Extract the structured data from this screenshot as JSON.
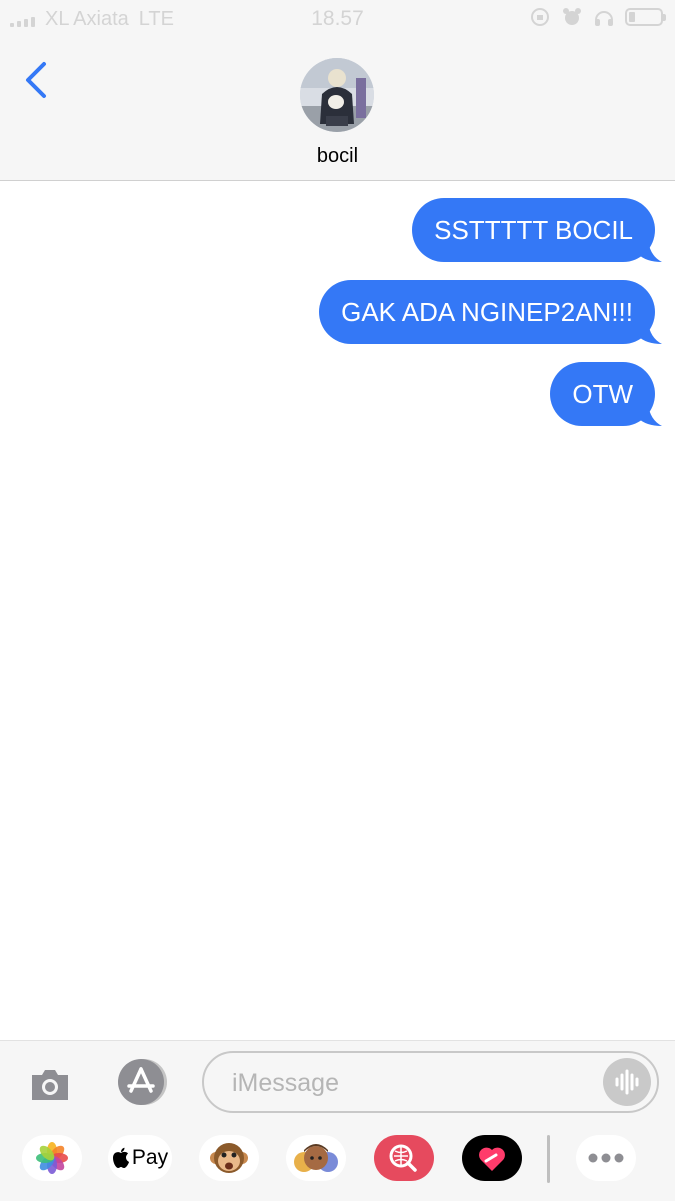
{
  "status_bar": {
    "carrier": "XL Axiata",
    "network": "LTE",
    "time": "18.57"
  },
  "header": {
    "contact_name": "bocil",
    "back_icon": "chevron-left-icon",
    "avatar": "contact-avatar-photo"
  },
  "messages": [
    {
      "text": "SSTTTTT BOCIL",
      "sender": "me"
    },
    {
      "text": "GAK ADA NGINEP2AN!!!",
      "sender": "me"
    },
    {
      "text": "OTW",
      "sender": "me"
    }
  ],
  "composer": {
    "placeholder": "iMessage",
    "camera_icon": "camera-icon",
    "apps_icon": "app-store-icon",
    "audio_icon": "audio-waveform-icon"
  },
  "app_drawer": [
    {
      "name": "photos-icon"
    },
    {
      "name": "apple-pay-icon",
      "label": "Pay"
    },
    {
      "name": "animoji-icon"
    },
    {
      "name": "memoji-stickers-icon"
    },
    {
      "name": "web-search-icon"
    },
    {
      "name": "digital-touch-icon"
    },
    {
      "name": "more-icon"
    }
  ],
  "colors": {
    "bubble": "#3478f6",
    "accent": "#3478f6",
    "background": "#ffffff",
    "bar": "#f6f6f6"
  }
}
